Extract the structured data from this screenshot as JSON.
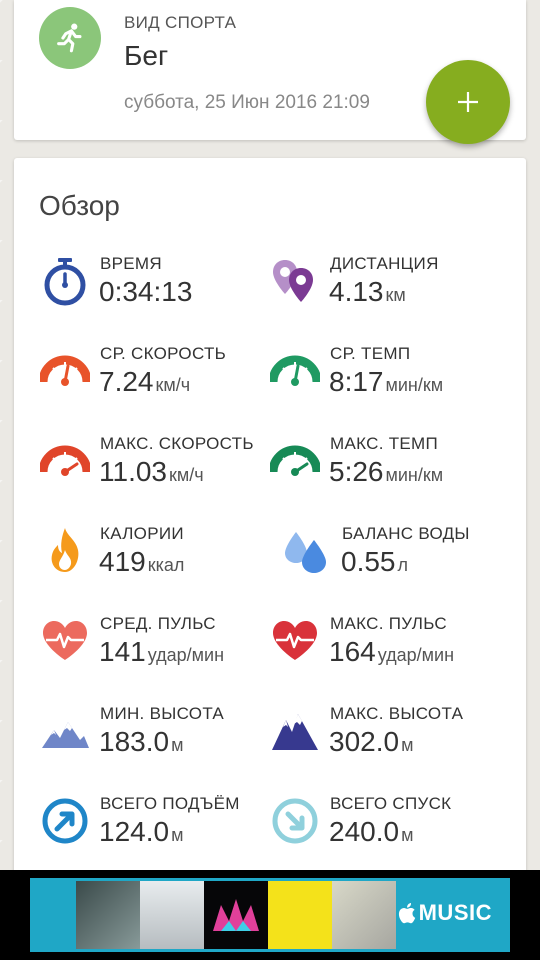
{
  "activity": {
    "sport_label": "ВИД СПОРТА",
    "sport_name": "Бег",
    "datetime": "суббота, 25 Июн 2016 21:09",
    "sport_icon": "running-icon",
    "fab_icon": "plus-icon"
  },
  "overview": {
    "title": "Обзор",
    "stats": {
      "time": {
        "label": "ВРЕМЯ",
        "value": "0:34:13",
        "unit": "",
        "icon": "stopwatch-icon"
      },
      "distance": {
        "label": "ДИСТАНЦИЯ",
        "value": "4.13",
        "unit": "км",
        "icon": "map-pins-icon"
      },
      "avg_speed": {
        "label": "СР. СКОРОСТЬ",
        "value": "7.24",
        "unit": "км/ч",
        "icon": "speedometer-icon"
      },
      "avg_pace": {
        "label": "СР. ТЕМП",
        "value": "8:17",
        "unit": "мин/км",
        "icon": "pace-gauge-icon"
      },
      "max_speed": {
        "label": "МАКС. СКОРОСТЬ",
        "value": "11.03",
        "unit": "км/ч",
        "icon": "speedometer-max-icon"
      },
      "max_pace": {
        "label": "МАКС. ТЕМП",
        "value": "5:26",
        "unit": "мин/км",
        "icon": "pace-gauge-max-icon"
      },
      "calories": {
        "label": "КАЛОРИИ",
        "value": "419",
        "unit": "ккал",
        "icon": "flame-icon"
      },
      "water": {
        "label": "БАЛАНС ВОДЫ",
        "value": "0.55",
        "unit": "л",
        "icon": "water-drops-icon"
      },
      "avg_hr": {
        "label": "СРЕД. ПУЛЬС",
        "value": "141",
        "unit": "удар/мин",
        "icon": "heart-pulse-icon"
      },
      "max_hr": {
        "label": "МАКС. ПУЛЬС",
        "value": "164",
        "unit": "удар/мин",
        "icon": "heart-pulse-max-icon"
      },
      "min_alt": {
        "label": "МИН. ВЫСОТА",
        "value": "183.0",
        "unit": "м",
        "icon": "mountains-icon"
      },
      "max_alt": {
        "label": "МАКС. ВЫСОТА",
        "value": "302.0",
        "unit": "м",
        "icon": "mountains-max-icon"
      },
      "ascent": {
        "label": "ВСЕГО ПОДЪЁМ",
        "value": "124.0",
        "unit": "м",
        "icon": "ascent-arrow-icon"
      },
      "descent": {
        "label": "ВСЕГО СПУСК",
        "value": "240.0",
        "unit": "м",
        "icon": "descent-arrow-icon"
      }
    }
  },
  "ad": {
    "brand": "MUSIC",
    "brand_icon": "apple-logo-icon"
  },
  "colors": {
    "sport_avatar": "#8bc67a",
    "fab": "#86ad1f",
    "ad_background": "#1fa7c6"
  }
}
